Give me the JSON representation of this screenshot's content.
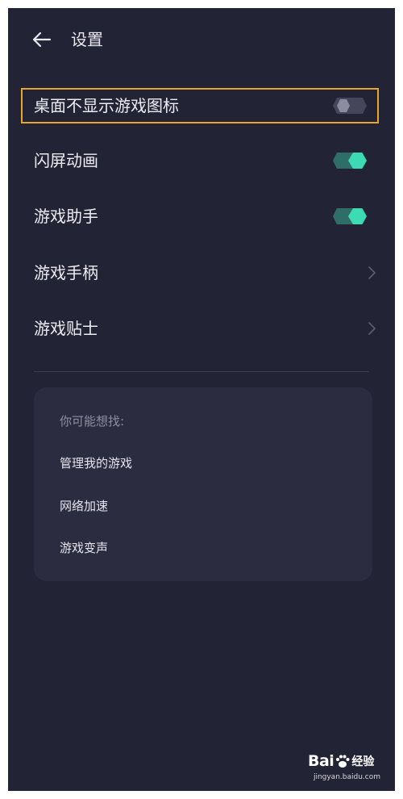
{
  "header": {
    "title": "设置"
  },
  "settings": [
    {
      "label": "桌面不显示游戏图标",
      "control": "toggle",
      "state": "off"
    },
    {
      "label": "闪屏动画",
      "control": "toggle",
      "state": "on"
    },
    {
      "label": "游戏助手",
      "control": "toggle",
      "state": "on"
    },
    {
      "label": "游戏手柄",
      "control": "chevron"
    },
    {
      "label": "游戏贴士",
      "control": "chevron"
    }
  ],
  "suggestions": {
    "title": "你可能想找:",
    "items": [
      "管理我的游戏",
      "网络加速",
      "游戏变声"
    ]
  },
  "watermark": {
    "brand_left": "Bai",
    "brand_right": "经验",
    "url": "jingyan.baidu.com"
  },
  "colors": {
    "background": "#232336",
    "card": "#2c2c41",
    "accent": "#3ddbb4",
    "toggle_on_track": "#2f6e68",
    "toggle_off_track": "#45465a",
    "highlight_border": "#e8a62e"
  },
  "icons": {
    "back": "arrow-left-icon",
    "chevron": "chevron-right-icon",
    "toggle": "toggle-switch-icon",
    "watermark": "paw-icon"
  }
}
